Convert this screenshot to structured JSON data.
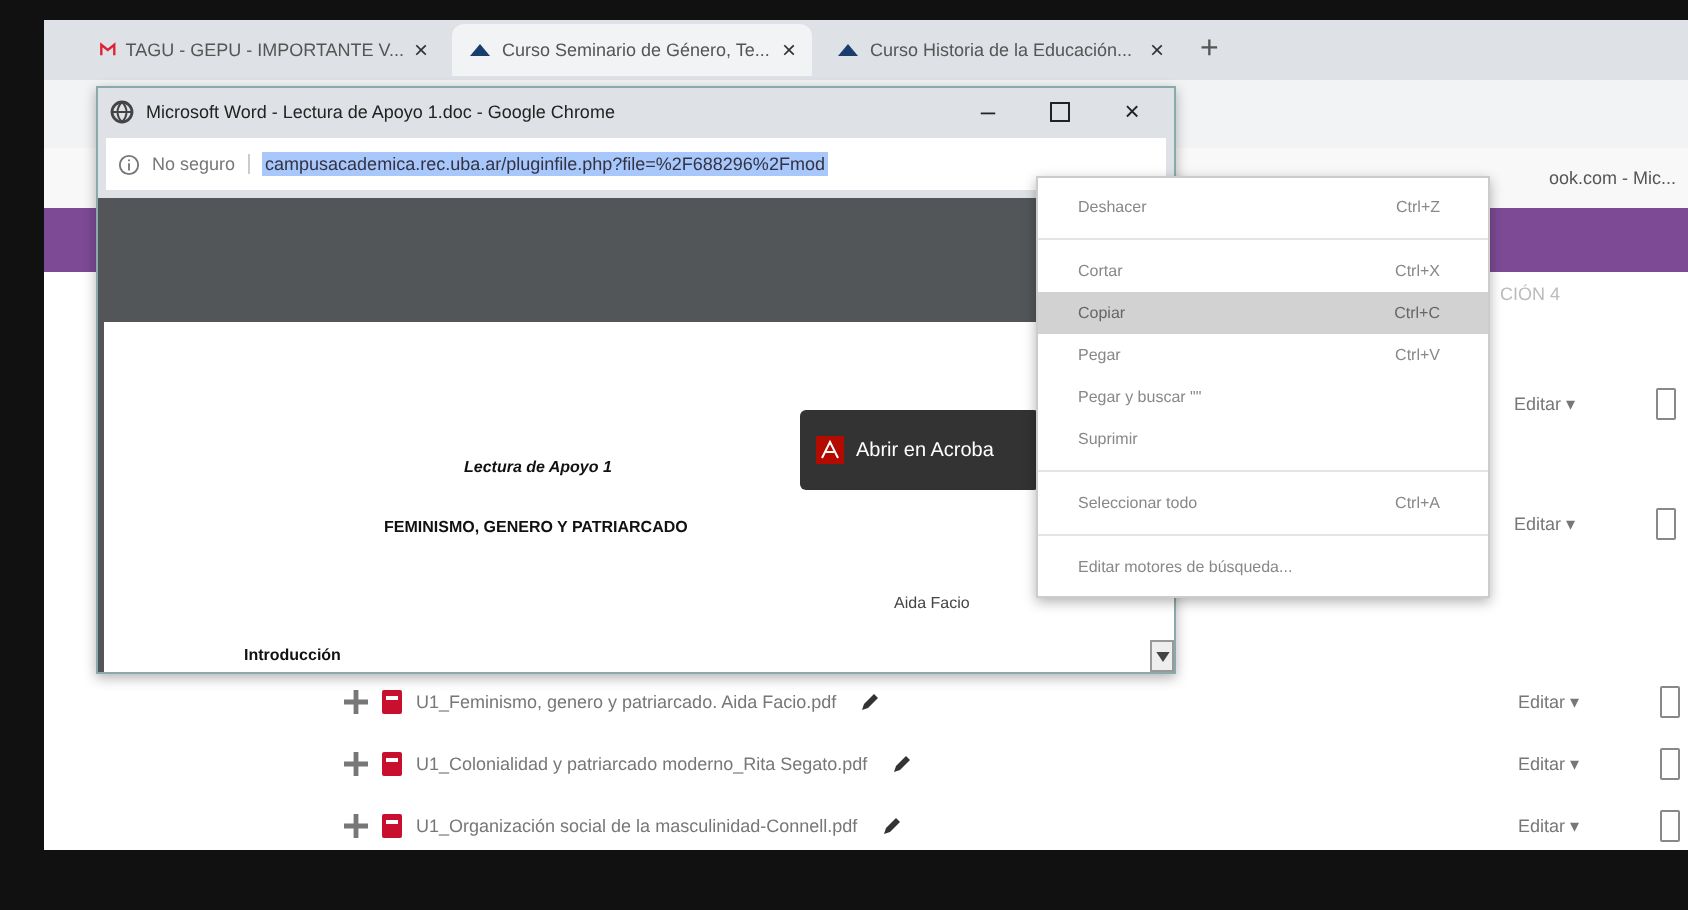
{
  "browser": {
    "tabs": [
      {
        "title": "TAGU - GEPU - IMPORTANTE V...",
        "kind": "mail",
        "selected": false,
        "close": "×"
      },
      {
        "title": "Curso Seminario de Género, Te...",
        "kind": "cloud",
        "selected": true,
        "close": "×"
      },
      {
        "title": "Curso Historia de la Educación...",
        "kind": "cloud",
        "selected": false,
        "close": "×"
      }
    ],
    "new_tab": "+",
    "bookmark": "ook.com - Mic..."
  },
  "course": {
    "section_heading": "CIÓN 4",
    "edit_links": [
      "Editar ▾",
      "Editar ▾"
    ],
    "files": [
      {
        "name": "U1_Feminismo, genero y patriarcado. Aida Facio.pdf",
        "edit": "Editar ▾"
      },
      {
        "name": "U1_Colonialidad y patriarcado moderno_Rita Segato.pdf",
        "edit": "Editar ▾"
      },
      {
        "name": "U1_Organización social de la masculinidad-Connell.pdf",
        "edit": "Editar ▾"
      }
    ]
  },
  "popup": {
    "title": "Microsoft Word - Lectura de Apoyo 1.doc - Google Chrome",
    "minimize": "–",
    "close": "×",
    "security": "No seguro",
    "url": "campusacademica.rec.uba.ar/pluginfile.php?file=%2F688296%2Fmod",
    "open_button": "Abrir en Acroba",
    "document": {
      "subtitle": "Lectura de Apoyo 1",
      "title": "FEMINISMO, GENERO Y PATRIARCADO",
      "author": "Aida Facio",
      "section": "Introducción"
    }
  },
  "context_menu": [
    {
      "kind": "item",
      "label": "Deshacer",
      "shortcut": "Ctrl+Z",
      "selected": false
    },
    {
      "kind": "separator"
    },
    {
      "kind": "item",
      "label": "Cortar",
      "shortcut": "Ctrl+X",
      "selected": false
    },
    {
      "kind": "item",
      "label": "Copiar",
      "shortcut": "Ctrl+C",
      "selected": true
    },
    {
      "kind": "item",
      "label": "Pegar",
      "shortcut": "Ctrl+V",
      "selected": false
    },
    {
      "kind": "item",
      "label": "Pegar y buscar \"\"",
      "selected": false
    },
    {
      "kind": "item",
      "label": "Suprimir",
      "selected": false
    },
    {
      "kind": "separator"
    },
    {
      "kind": "item",
      "label": "Seleccionar todo",
      "shortcut": "Ctrl+A",
      "selected": false
    },
    {
      "kind": "separator"
    },
    {
      "kind": "item",
      "label": "Editar motores de búsqueda...",
      "selected": false
    }
  ]
}
